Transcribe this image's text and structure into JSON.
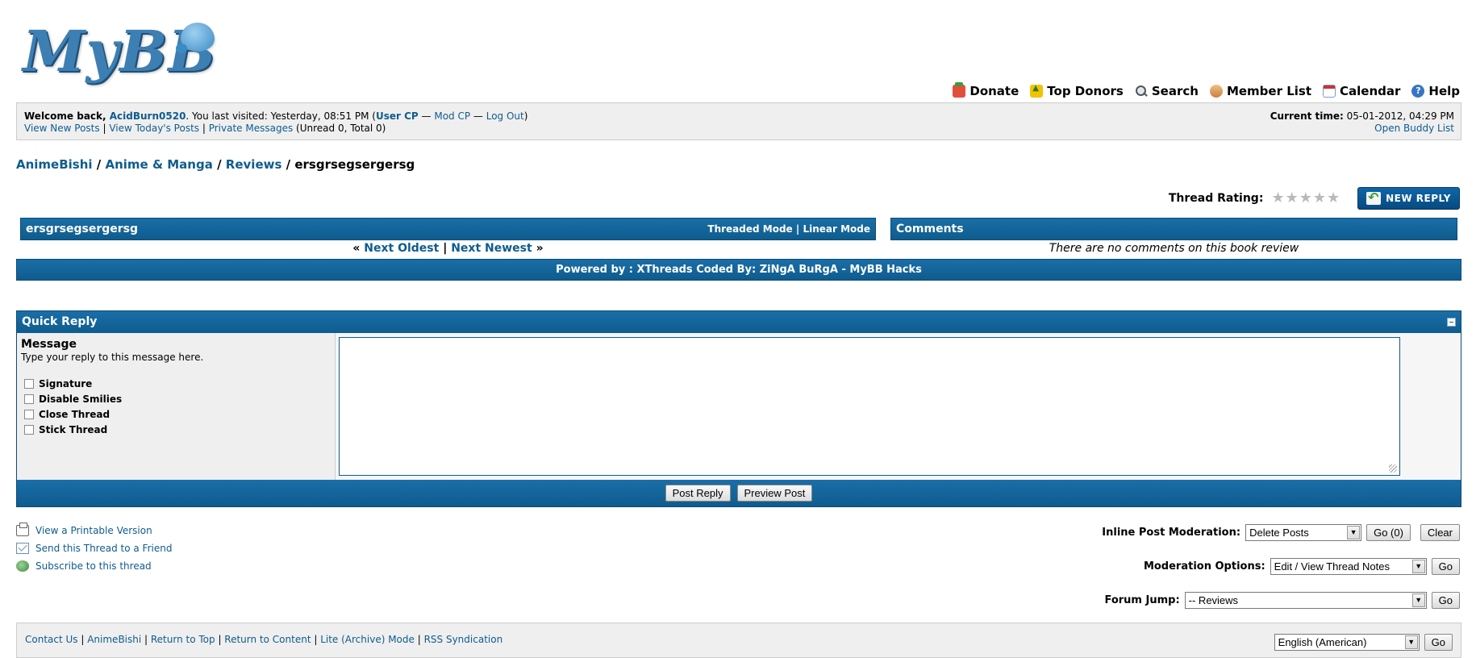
{
  "logo": {
    "text": "MyBB"
  },
  "top_menu": [
    {
      "label": "Donate",
      "icon": "donate-icon"
    },
    {
      "label": "Top Donors",
      "icon": "top-donors-icon"
    },
    {
      "label": "Search",
      "icon": "search-icon"
    },
    {
      "label": "Member List",
      "icon": "member-list-icon"
    },
    {
      "label": "Calendar",
      "icon": "calendar-icon"
    },
    {
      "label": "Help",
      "icon": "help-icon"
    }
  ],
  "welcome": {
    "prefix": "Welcome back, ",
    "username": "AcidBurn0520",
    "last_visited": ". You last visited: Yesterday, 08:51 PM (",
    "user_cp": "User CP",
    "dash1": " — ",
    "mod_cp": "Mod CP",
    "dash2": " — ",
    "log_out": "Log Out",
    "close_paren": ")",
    "view_new_posts": "View New Posts",
    "sep": " | ",
    "view_todays_posts": "View Today's Posts",
    "private_messages": "Private Messages",
    "pm_counts": " (Unread 0, Total 0)",
    "current_time_label": "Current time:",
    "current_time_value": " 05-01-2012, 04:29 PM",
    "open_buddy_list": "Open Buddy List"
  },
  "breadcrumb": {
    "items": [
      "AnimeBishi",
      "Anime & Manga",
      "Reviews"
    ],
    "sep": " / ",
    "current": "ersgrsegsergersg"
  },
  "rating": {
    "label": "Thread Rating:",
    "stars": 5,
    "value": 0
  },
  "new_reply_button": "NEW REPLY",
  "thread": {
    "title": "ersgrsegsergersg",
    "threaded_mode": "Threaded Mode",
    "modes_sep": " | ",
    "linear_mode": "Linear Mode",
    "nav_prefix": "« ",
    "next_oldest": "Next Oldest",
    "nav_sep": " | ",
    "next_newest": "Next Newest",
    "nav_suffix": " »"
  },
  "comments": {
    "title": "Comments",
    "empty": "There are no comments on this book review"
  },
  "powered_by": "Powered by : XThreads Coded By: ZiNgA BuRgA - MyBB Hacks",
  "quick_reply": {
    "title": "Quick Reply",
    "message_title": "Message",
    "message_desc": "Type your reply to this message here.",
    "options": [
      "Signature",
      "Disable Smilies",
      "Close Thread",
      "Stick Thread"
    ],
    "textarea_value": "",
    "post_reply": "Post Reply",
    "preview_post": "Preview Post"
  },
  "bottom_links": {
    "printable": "View a Printable Version",
    "send_friend": "Send this Thread to a Friend",
    "subscribe": "Subscribe to this thread"
  },
  "moderation": {
    "inline_label": "Inline Post Moderation:",
    "inline_select": "Delete Posts",
    "inline_go": "Go (0)",
    "clear": "Clear",
    "options_label": "Moderation Options:",
    "options_select": "Edit / View Thread Notes",
    "options_go": "Go",
    "jump_label": "Forum Jump:",
    "jump_select": "-- Reviews",
    "jump_go": "Go"
  },
  "footer": {
    "links": [
      "Contact Us",
      "AnimeBishi",
      "Return to Top",
      "Return to Content",
      "Lite (Archive) Mode",
      "RSS Syndication"
    ],
    "sep": " | ",
    "language": "English (American)",
    "language_go": "Go"
  },
  "colors": {
    "header_blue": "#0f5c8e",
    "link_blue": "#0f5c8e",
    "panel_gray": "#efefef"
  }
}
